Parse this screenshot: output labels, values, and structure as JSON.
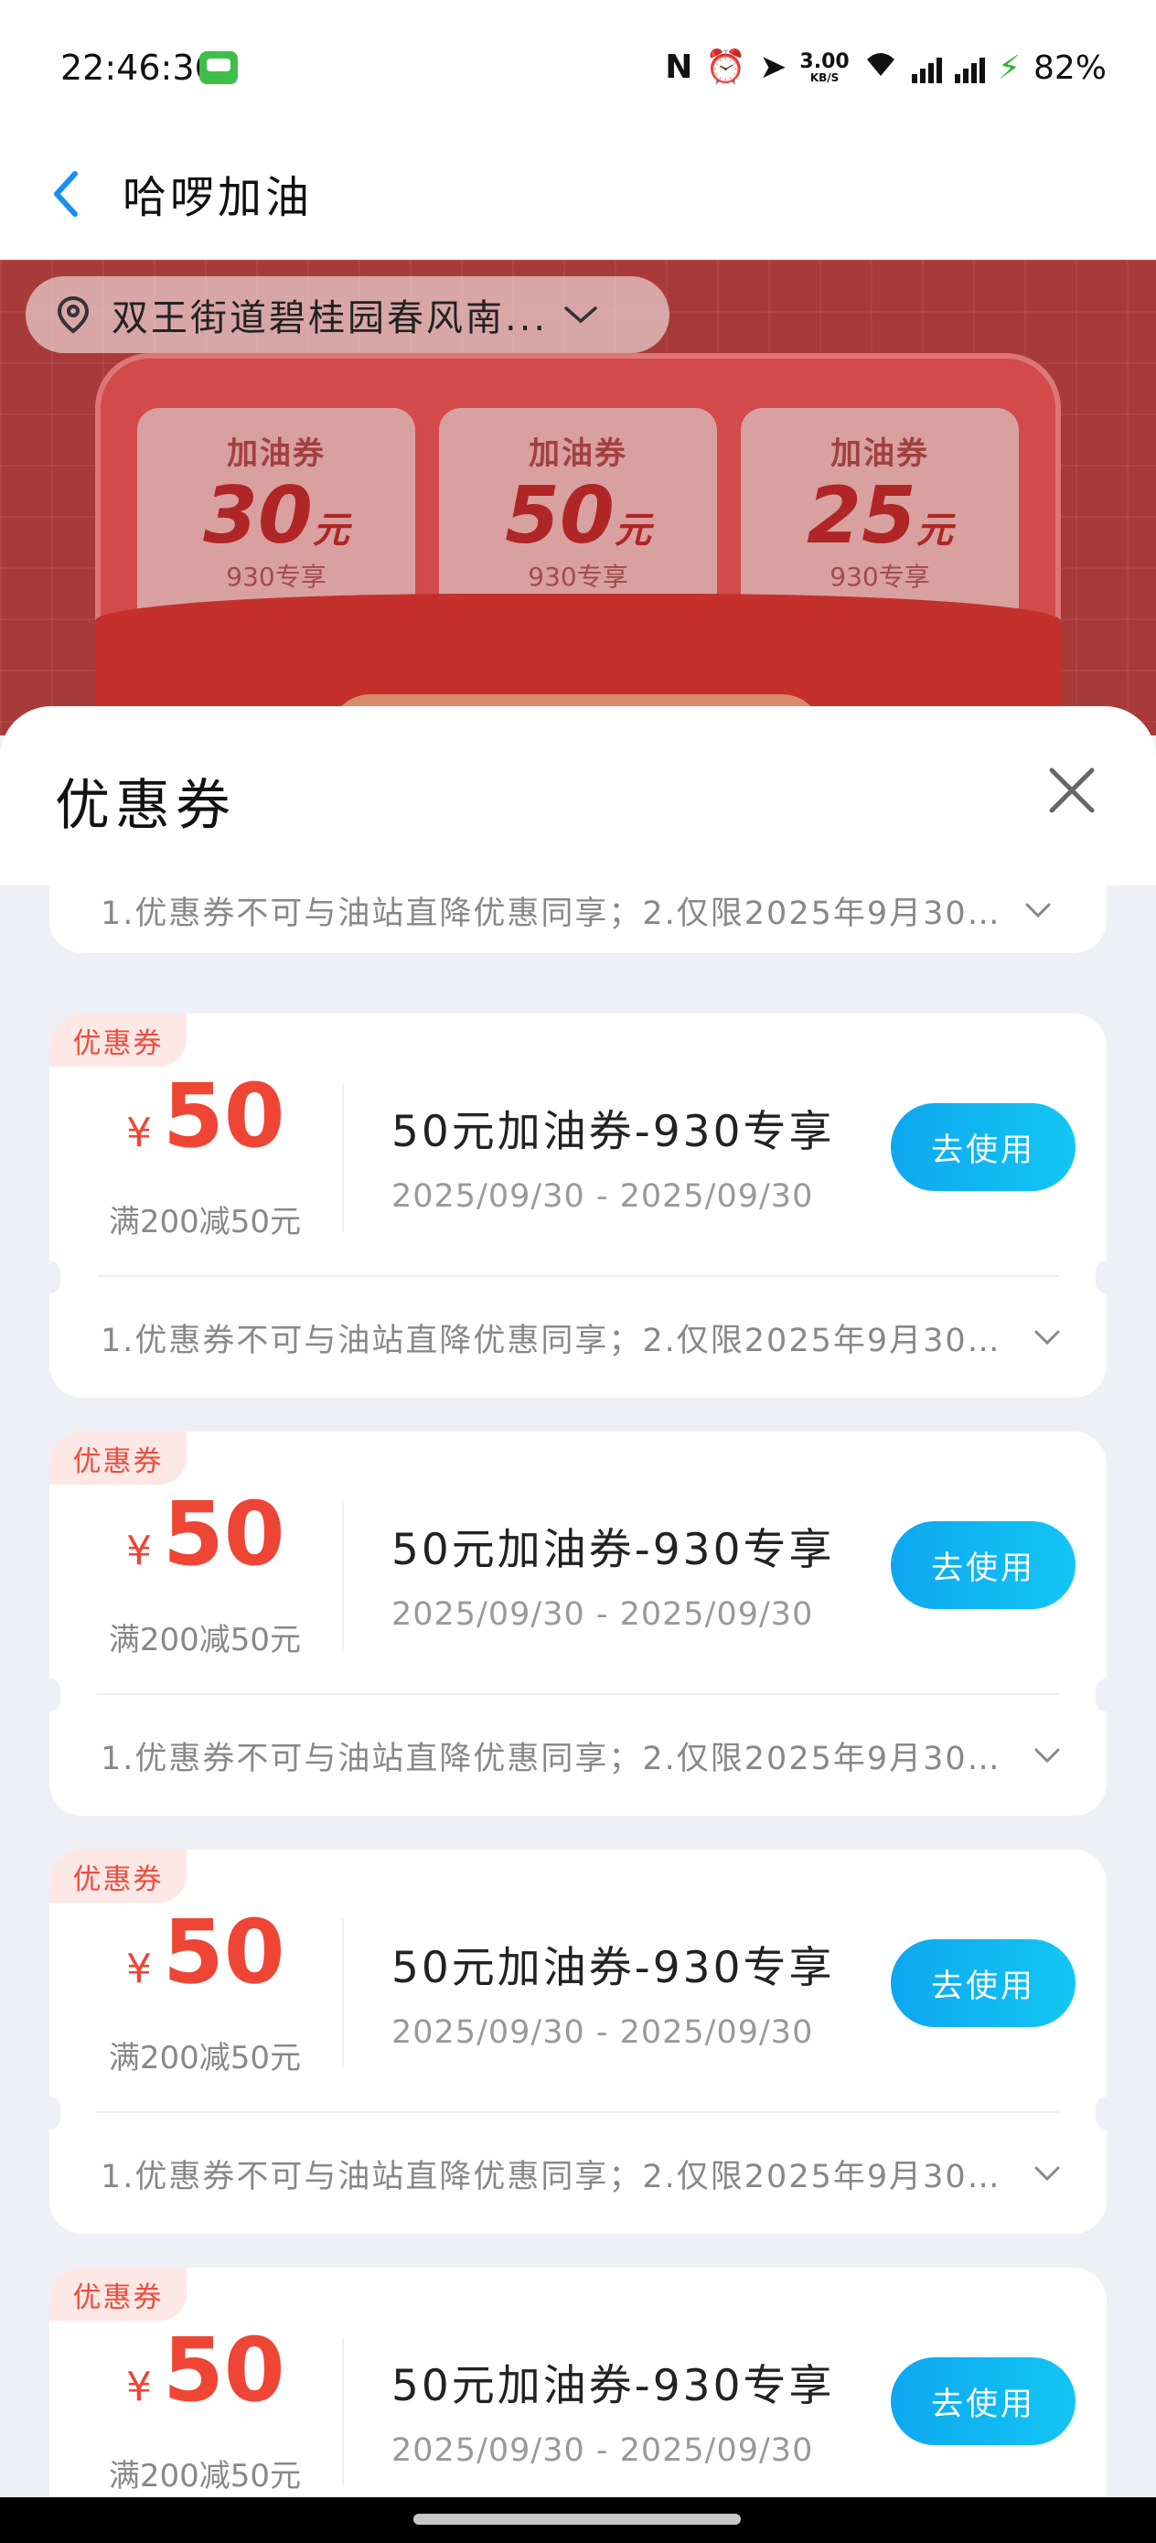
{
  "status_bar": {
    "time": "22:46:36",
    "speed_value": "3.00",
    "speed_unit": "KB/S",
    "battery": "82%"
  },
  "header": {
    "title": "哈啰加油"
  },
  "banner": {
    "location": "双王街道碧桂园春风南...",
    "tickets": [
      {
        "label": "加油券",
        "amount": "30",
        "unit": "元",
        "sub": "930专享"
      },
      {
        "label": "加油券",
        "amount": "50",
        "unit": "元",
        "sub": "930专享"
      },
      {
        "label": "加油券",
        "amount": "25",
        "unit": "元",
        "sub": "930专享"
      }
    ]
  },
  "sheet": {
    "title": "优惠券",
    "first_rules": "1.优惠券不可与油站直降优惠同享；2.仅限2025年9月30…",
    "coupons": [
      {
        "tag": "优惠券",
        "currency": "¥",
        "amount": "50",
        "condition": "满200减50元",
        "name": "50元加油券-930专享",
        "date_range": "2025/09/30 - 2025/09/30",
        "button": "去使用",
        "rules": "1.优惠券不可与油站直降优惠同享；2.仅限2025年9月30…"
      },
      {
        "tag": "优惠券",
        "currency": "¥",
        "amount": "50",
        "condition": "满200减50元",
        "name": "50元加油券-930专享",
        "date_range": "2025/09/30 - 2025/09/30",
        "button": "去使用",
        "rules": "1.优惠券不可与油站直降优惠同享；2.仅限2025年9月30…"
      },
      {
        "tag": "优惠券",
        "currency": "¥",
        "amount": "50",
        "condition": "满200减50元",
        "name": "50元加油券-930专享",
        "date_range": "2025/09/30 - 2025/09/30",
        "button": "去使用",
        "rules": "1.优惠券不可与油站直降优惠同享；2.仅限2025年9月30…"
      },
      {
        "tag": "优惠券",
        "currency": "¥",
        "amount": "50",
        "condition": "满200减50元",
        "name": "50元加油券-930专享",
        "date_range": "2025/09/30 - 2025/09/30",
        "button": "去使用",
        "rules": ""
      }
    ]
  },
  "icons": {
    "back": "chevron-left-icon",
    "location": "location-pin-icon",
    "dropdown": "chevron-down-icon",
    "close": "close-icon",
    "accent_blue": "#0ea7ef",
    "accent_red": "#ef4535"
  }
}
